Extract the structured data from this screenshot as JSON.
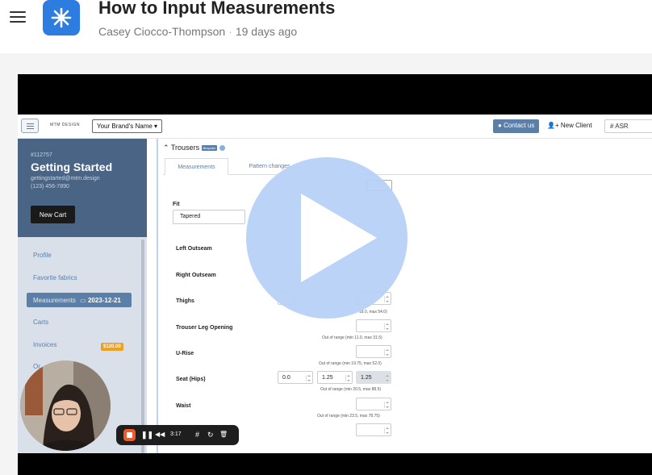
{
  "header": {
    "title": "How to Input Measurements",
    "author": "Casey Ciocco-Thompson",
    "age": "19 days ago"
  },
  "app": {
    "logo_text": "MTM DESIGN",
    "brand_select": "Your Brand's Name",
    "contact_label": "Contact us",
    "new_client_label": "New Client",
    "asr_select": "# ASR"
  },
  "client": {
    "id": "#112757",
    "name": "Getting Started",
    "email": "gettingstarted@mtm.design",
    "phone": "(123) 456-7890",
    "new_cart_label": "New Cart"
  },
  "sidebar": {
    "items": [
      {
        "label": "Profile"
      },
      {
        "label": "Favorite fabrics"
      },
      {
        "label": "Measurements",
        "date": "2023-12-21"
      },
      {
        "label": "Carts"
      },
      {
        "label": "Invoices",
        "badge": "$120.00"
      },
      {
        "label": "Or"
      }
    ]
  },
  "main": {
    "section_title": "Trousers",
    "bespoke_badge": "Bespoke",
    "tabs": [
      "Measurements",
      "Pattern changes"
    ],
    "fit_label": "Fit",
    "fit_value": "Tapered",
    "rows": {
      "left_outseam": "Left Outseam",
      "right_outseam": "Right Outseam",
      "thighs": "Thighs",
      "thighs_range": "18.0, max 54.0)",
      "trouser_leg_opening": "Trouser Leg Opening",
      "trouser_leg_opening_range": "Out of range (min 11.0, max 31.5)",
      "u_rise": "U-Rise",
      "u_rise_range": "Out of range (min 19.75, max 52.0)",
      "seat": "Seat (Hips)",
      "seat_values": [
        "0.0",
        "1.25",
        "1.25"
      ],
      "seat_range": "Out of range (min 20.5, max 88.5)",
      "waist": "Waist",
      "waist_range": "Out of range (min 23.5, max 78.75)"
    }
  },
  "recorder": {
    "time": "3:17"
  },
  "colors": {
    "accent": "#5b7fa6",
    "sidebar_header": "#4a6485",
    "sidebar_body": "#d9e0ea",
    "badge": "#f0a020",
    "record": "#f05a28",
    "play_overlay": "#b7d0f7",
    "logo": "#2d7de0"
  },
  "icons": [
    "menu-icon",
    "snowflake-logo-icon",
    "play-icon",
    "calendar-icon",
    "info-icon",
    "question-circle-icon",
    "user-plus-icon",
    "pause-icon",
    "rewind-icon",
    "grid-icon",
    "restart-icon",
    "trash-icon"
  ]
}
